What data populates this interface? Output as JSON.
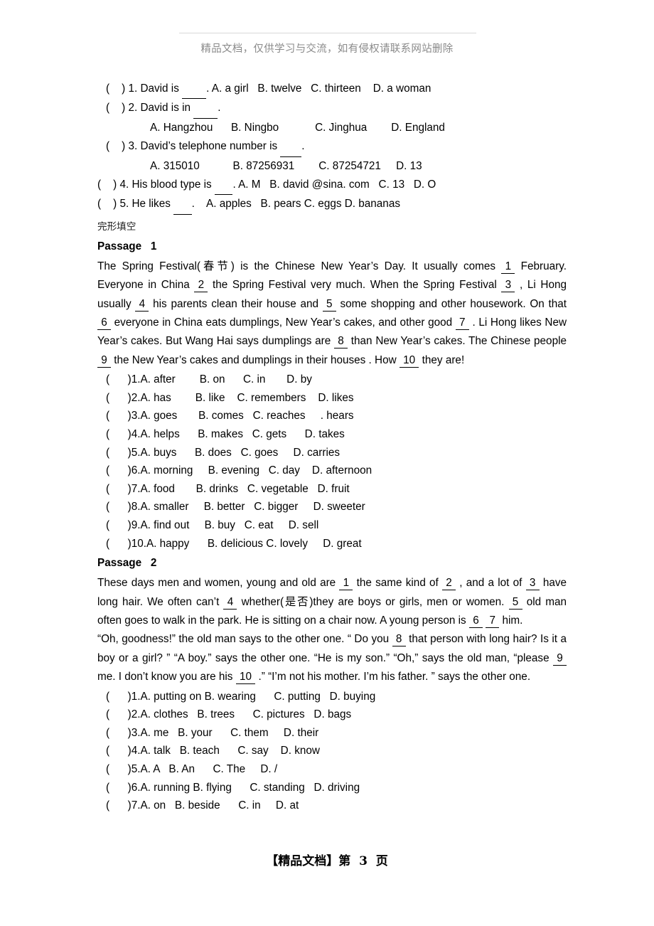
{
  "header": {
    "notice": "精品文档，仅供学习与交流，如有侵权请联系网站删除"
  },
  "top_questions": [
    {
      "id": "q1",
      "stem": "(    ) 1. David is ________. A. a girl   B. twelve   C. thirteen    D. a woman"
    },
    {
      "id": "q2",
      "stem": "(    ) 2. David is in ________."
    },
    {
      "id": "q2opts",
      "stem": "A. Hangzhou      B. Ningbo            C. Jinghua        D. England"
    },
    {
      "id": "q3",
      "stem": "(    ) 3. David’s telephone number is _______."
    },
    {
      "id": "q3opts",
      "stem": "A. 315010           B. 87256931        C. 87254721     D. 13"
    },
    {
      "id": "q4",
      "stem": "(    ) 4. His blood type is ______. A. M   B. david @sina. com   C. 13   D. O"
    },
    {
      "id": "q5",
      "stem": "(    ) 5. He likes ______.    A. apples   B. pears C. eggs D. bananas"
    }
  ],
  "section_label": "完形填空",
  "passage1": {
    "title": "Passage   1",
    "paragraphs": [
      "The Spring Festival(春节) is the Chinese New Year’s Day. It usually comes  1   February. Everyone in China   2   the Spring Festival very much. When the Spring Festival  3  , Li Hong usually   4   his parents clean their house and   5   some shopping and other housework. On that    6   everyone in China eats dumplings, New Year’s cakes, and other good   7  . Li Hong likes New Year’s cakes. But Wang Hai says dumplings are   8    than New Year’s cakes. The Chinese people   9   the New Year’s cakes and dumplings in their houses . How   10  they are!"
    ],
    "choices": [
      "(      )1.A. after        B. on      C. in       D. by",
      "(      )2.A. has        B. like    C. remembers    D. likes",
      "(      )3.A. goes       B. comes   C. reaches     . hears",
      "(      )4.A. helps      B. makes   C. gets      D. takes",
      "(      )5.A. buys      B. does   C. goes     D. carries",
      "(      )6.A. morning     B. evening   C. day    D. afternoon",
      "(      )7.A. food       B. drinks   C. vegetable   D. fruit",
      "(      )8.A. smaller     B. better   C. bigger     D. sweeter",
      "(      )9.A. find out     B. buy   C. eat     D. sell",
      "(      )10.A. happy      B. delicious C. lovely     D. great"
    ]
  },
  "passage2": {
    "title": "Passage   2",
    "paragraphs": [
      "These days men and women, young and old are   1    the same kind of   2   , and a lot of   3    have long hair. We often can’t   4    whether(是否)they are boys or girls, men or women.   5    old man often goes to walk in the park. He is sitting on a chair now. A young person is    6      7   him.",
      "“Oh, goodness!” the old man says to the other one. “ Do you    8   that person with long hair? Is it a boy or a girl? ” “A boy.” says the other one. “He is my son.” “Oh,” says the old man, “please  9   me. I don’t know you are his   10    .” “I’m not his mother. I’m his father. ” says the other one."
    ],
    "choices": [
      "(      )1.A. putting on B. wearing      C. putting   D. buying",
      "(      )2.A. clothes   B. trees      C. pictures   D. bags",
      "(      )3.A. me   B. your      C. them     D. their",
      "(      )4.A. talk   B. teach      C. say    D. know",
      "(      )5.A. A   B. An      C. The     D. /",
      "(      )6.A. running B. flying      C. standing   D. driving",
      "(      )7.A. on   B. beside      C. in     D. at"
    ]
  },
  "footer": {
    "text": "【精品文档】第  3  页"
  }
}
